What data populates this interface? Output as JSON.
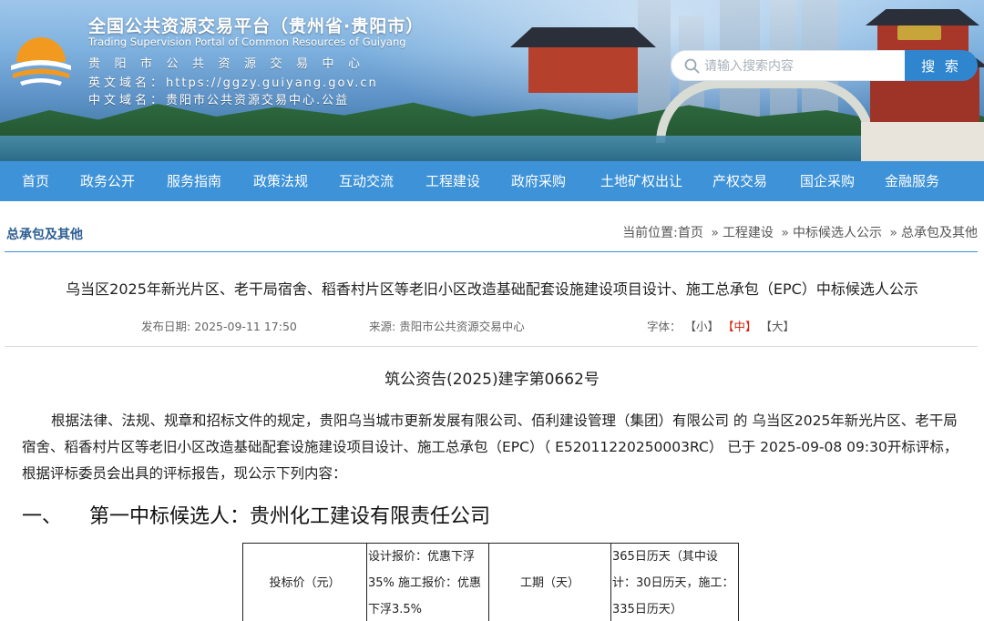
{
  "header": {
    "title": "全国公共资源交易平台（贵州省·贵阳市）",
    "subtitle_en": "Trading Supervision Portal of Common Resources of Guiyang",
    "center_name": "贵阳市公共资源交易中心",
    "en_domain_label": "英文域名：",
    "en_domain_value": "https://ggzy.guiyang.gov.cn",
    "cn_domain_label": "中文域名：",
    "cn_domain_value": "贵阳市公共资源交易中心.公益"
  },
  "search": {
    "placeholder": "请输入搜索内容",
    "button_label": "搜 索",
    "icon": "search-icon"
  },
  "nav": {
    "items": [
      "首页",
      "政务公开",
      "服务指南",
      "政策法规",
      "互动交流",
      "工程建设",
      "政府采购",
      "土地矿权出让",
      "产权交易",
      "国企采购",
      "金融服务"
    ]
  },
  "section": {
    "title": "总承包及其他"
  },
  "breadcrumb": {
    "prefix": "当前位置:",
    "items": [
      "首页",
      "工程建设",
      "中标候选人公示",
      "总承包及其他"
    ],
    "separator": "»"
  },
  "article": {
    "title": "乌当区2025年新光片区、老干局宿舍、稻香村片区等老旧小区改造基础配套设施建设项目设计、施工总承包（EPC）中标候选人公示",
    "publish_label": "发布日期:",
    "publish_date": "2025-09-11 17:50",
    "source_label": "来源:",
    "source_value": "贵阳市公共资源交易中心",
    "font_label": "字体：",
    "font_small": "【小】",
    "font_medium": "【中】",
    "font_large": "【大】",
    "doc_number": "筑公资告(2025)建字第0662号",
    "paragraph": "根据法律、法规、规章和招标文件的规定，贵阳乌当城市更新发展有限公司、佰利建设管理（集团）有限公司 的 乌当区2025年新光片区、老干局宿舍、稻香村片区等老旧小区改造基础配套设施建设项目设计、施工总承包（EPC）（ E52011220250003RC） 已于 2025-09-08 09:30开标评标，根据评标委员会出具的评标报告，现公示下列内容：",
    "heading_num": "一、",
    "heading_text": "第一中标候选人：贵州化工建设有限责任公司"
  },
  "table": {
    "row1": {
      "bid_price_label": "投标价（元）",
      "bid_price_value": "设计报价：优惠下浮35% 施工报价：优惠下浮3.5%",
      "duration_label": "工期（天）",
      "duration_value": "365日历天（其中设计：30日历天，施工：335日历天）"
    }
  },
  "colors": {
    "nav_bg": "#3d92d8",
    "search_button": "#2f86cf",
    "section_title": "#2c5e93",
    "active_font_option": "#d81e06"
  }
}
